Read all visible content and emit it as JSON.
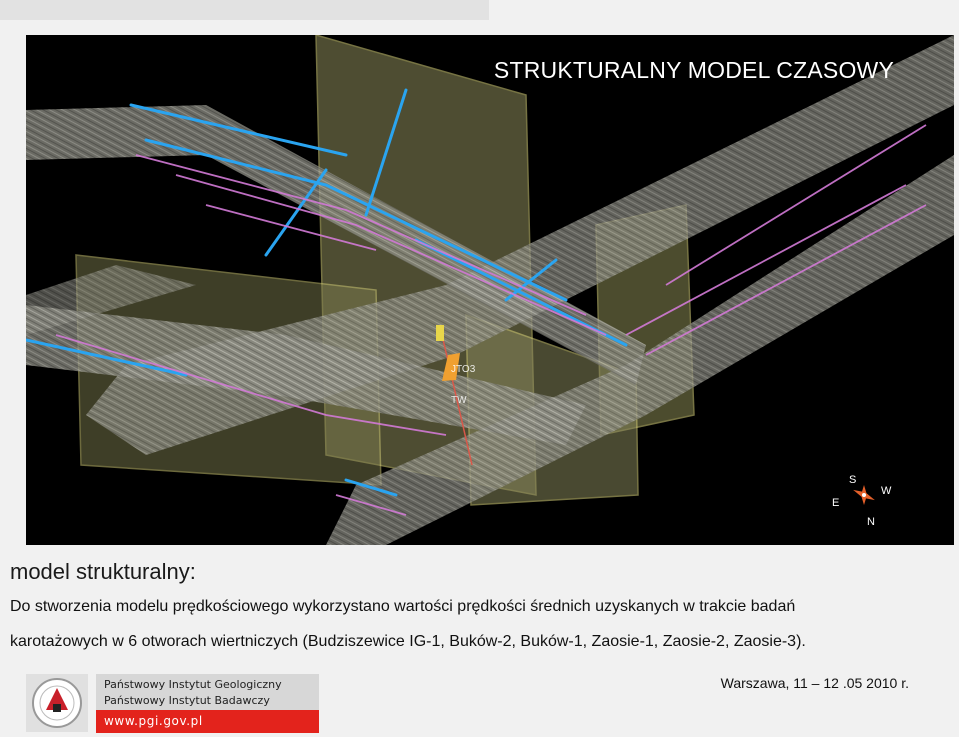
{
  "model_view": {
    "title": "STRUKTURALNY MODEL CZASOWY",
    "compass": {
      "south": "S",
      "west": "W",
      "east": "E",
      "north": "N"
    },
    "well_labels": [
      "JTO3",
      "TW"
    ]
  },
  "text": {
    "heading": "model strukturalny:",
    "line1": "Do stworzenia modelu prędkościowego wykorzystano wartości prędkości średnich uzyskanych w trakcie badań",
    "line2": "karotażowych w 6 otworach wiertniczych (Budziszewice IG-1, Buków-2, Buków-1, Zaosie-1, Zaosie-2, Zaosie-3)."
  },
  "footer": {
    "institute_line1": "Państwowy Instytut Geologiczny",
    "institute_line2": "Państwowy Instytut Badawczy",
    "url": "www.pgi.gov.pl",
    "date": "Warszawa, 11 – 12 .05  2010 r."
  },
  "colors": {
    "accent_red": "#e3231c",
    "panel_yellow": "#c8c35a",
    "horizon_blue": "#2aa4f0",
    "horizon_pink": "#d27ad6"
  }
}
